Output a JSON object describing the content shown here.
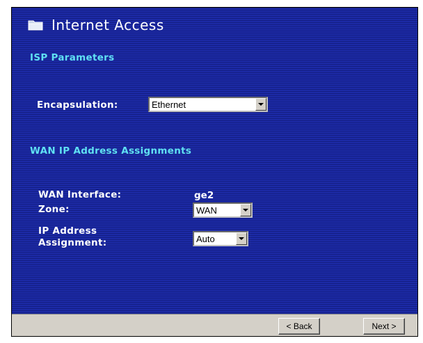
{
  "title": "Internet Access",
  "isp_section": {
    "heading": "ISP Parameters",
    "encapsulation_label": "Encapsulation:",
    "encapsulation_value": "Ethernet"
  },
  "wan_section": {
    "heading": "WAN IP Address Assignments",
    "interface_label": "WAN Interface:",
    "interface_value": "ge2",
    "zone_label": "Zone:",
    "zone_value": "WAN",
    "ip_assignment_label_line1": "IP Address",
    "ip_assignment_label_line2": "Assignment:",
    "ip_assignment_value": "Auto"
  },
  "footer": {
    "back_label": "< Back",
    "next_label": "Next >"
  },
  "colors": {
    "panel_background": "#1c2aa6",
    "heading_text": "#5fe0f2",
    "label_text": "#ffffff",
    "footer_background": "#d4d0c8"
  },
  "icons": {
    "title": "folder-icon",
    "dropdown": "chevron-down-icon"
  }
}
